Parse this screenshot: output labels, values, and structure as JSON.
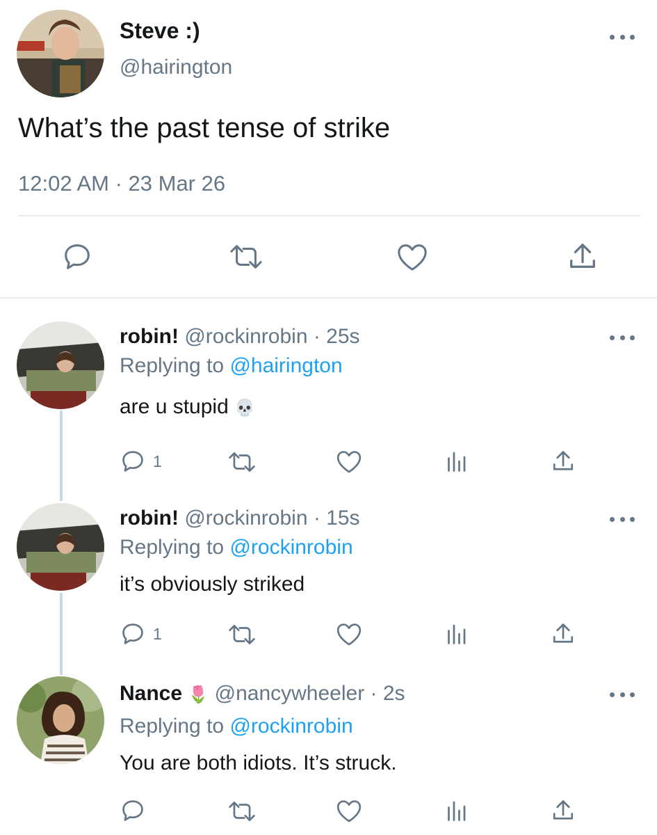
{
  "main_tweet": {
    "name": "Steve :)",
    "handle": "@hairington",
    "text": "What’s the past tense of strike",
    "timestamp": "12:02 AM · 23 Mar 26",
    "avatar_icon": "avatar-steve-icon",
    "actions": [
      "reply-icon",
      "retweet-icon",
      "like-icon",
      "share-icon"
    ]
  },
  "replies": [
    {
      "name": "robin!",
      "handle": "@rockinrobin",
      "age": "· 25s",
      "replying_label": "Replying to",
      "replying_to": "@hairington",
      "text": "are u stupid",
      "emoji": "💀",
      "reply_count": "1"
    },
    {
      "name": "robin!",
      "handle": "@rockinrobin",
      "age": "· 15s",
      "replying_label": "Replying to",
      "replying_to": "@rockinrobin",
      "text": "it’s obviously striked",
      "emoji": "",
      "reply_count": "1"
    },
    {
      "name": "Nance",
      "name_emoji": "🌷",
      "handle": "@nancywheeler",
      "age": "· 2s",
      "replying_label": "Replying to",
      "replying_to": "@rockinrobin",
      "text": "You are both idiots. It’s struck.",
      "emoji": "",
      "reply_count": ""
    }
  ],
  "colors": {
    "text": "#14171a",
    "secondary": "#657786",
    "link": "#1da1f2",
    "divider": "#e6ecf0",
    "thread": "#ccd6dd"
  }
}
